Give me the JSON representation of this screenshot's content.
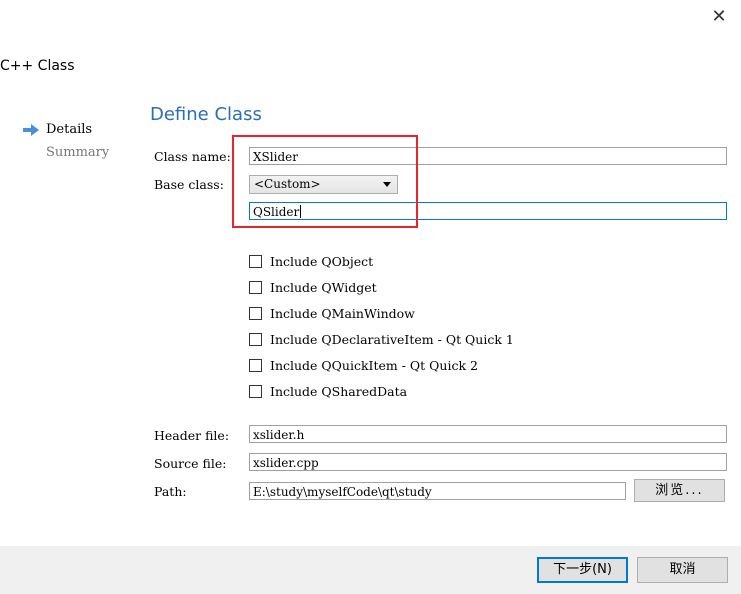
{
  "window": {
    "close_glyph": "✕",
    "wizard_title": "C++ Class"
  },
  "steps": [
    {
      "label": "Details",
      "active": true,
      "icon": "arrow-right-icon"
    },
    {
      "label": "Summary",
      "active": false
    }
  ],
  "page_title": "Define Class",
  "class_name": {
    "label": "Class name:",
    "value": "XSlider"
  },
  "base_class": {
    "label": "Base class:",
    "selected": "<Custom>",
    "custom_value": "QSlider"
  },
  "checkboxes": [
    {
      "label": "Include QObject",
      "checked": false
    },
    {
      "label": "Include QWidget",
      "checked": false
    },
    {
      "label": "Include QMainWindow",
      "checked": false
    },
    {
      "label": "Include QDeclarativeItem - Qt Quick 1",
      "checked": false
    },
    {
      "label": "Include QQuickItem - Qt Quick 2",
      "checked": false
    },
    {
      "label": "Include QSharedData",
      "checked": false
    }
  ],
  "header_file": {
    "label": "Header file:",
    "value": "xslider.h"
  },
  "source_file": {
    "label": "Source file:",
    "value": "xslider.cpp"
  },
  "path": {
    "label": "Path:",
    "value": "E:\\study\\myselfCode\\qt\\study",
    "browse_label": "浏览..."
  },
  "footer": {
    "next_label": "下一步(N)",
    "cancel_label": "取消"
  },
  "colors": {
    "accent": "#2a6fb3",
    "highlight": "#e8242c",
    "focus": "#0078d7"
  }
}
